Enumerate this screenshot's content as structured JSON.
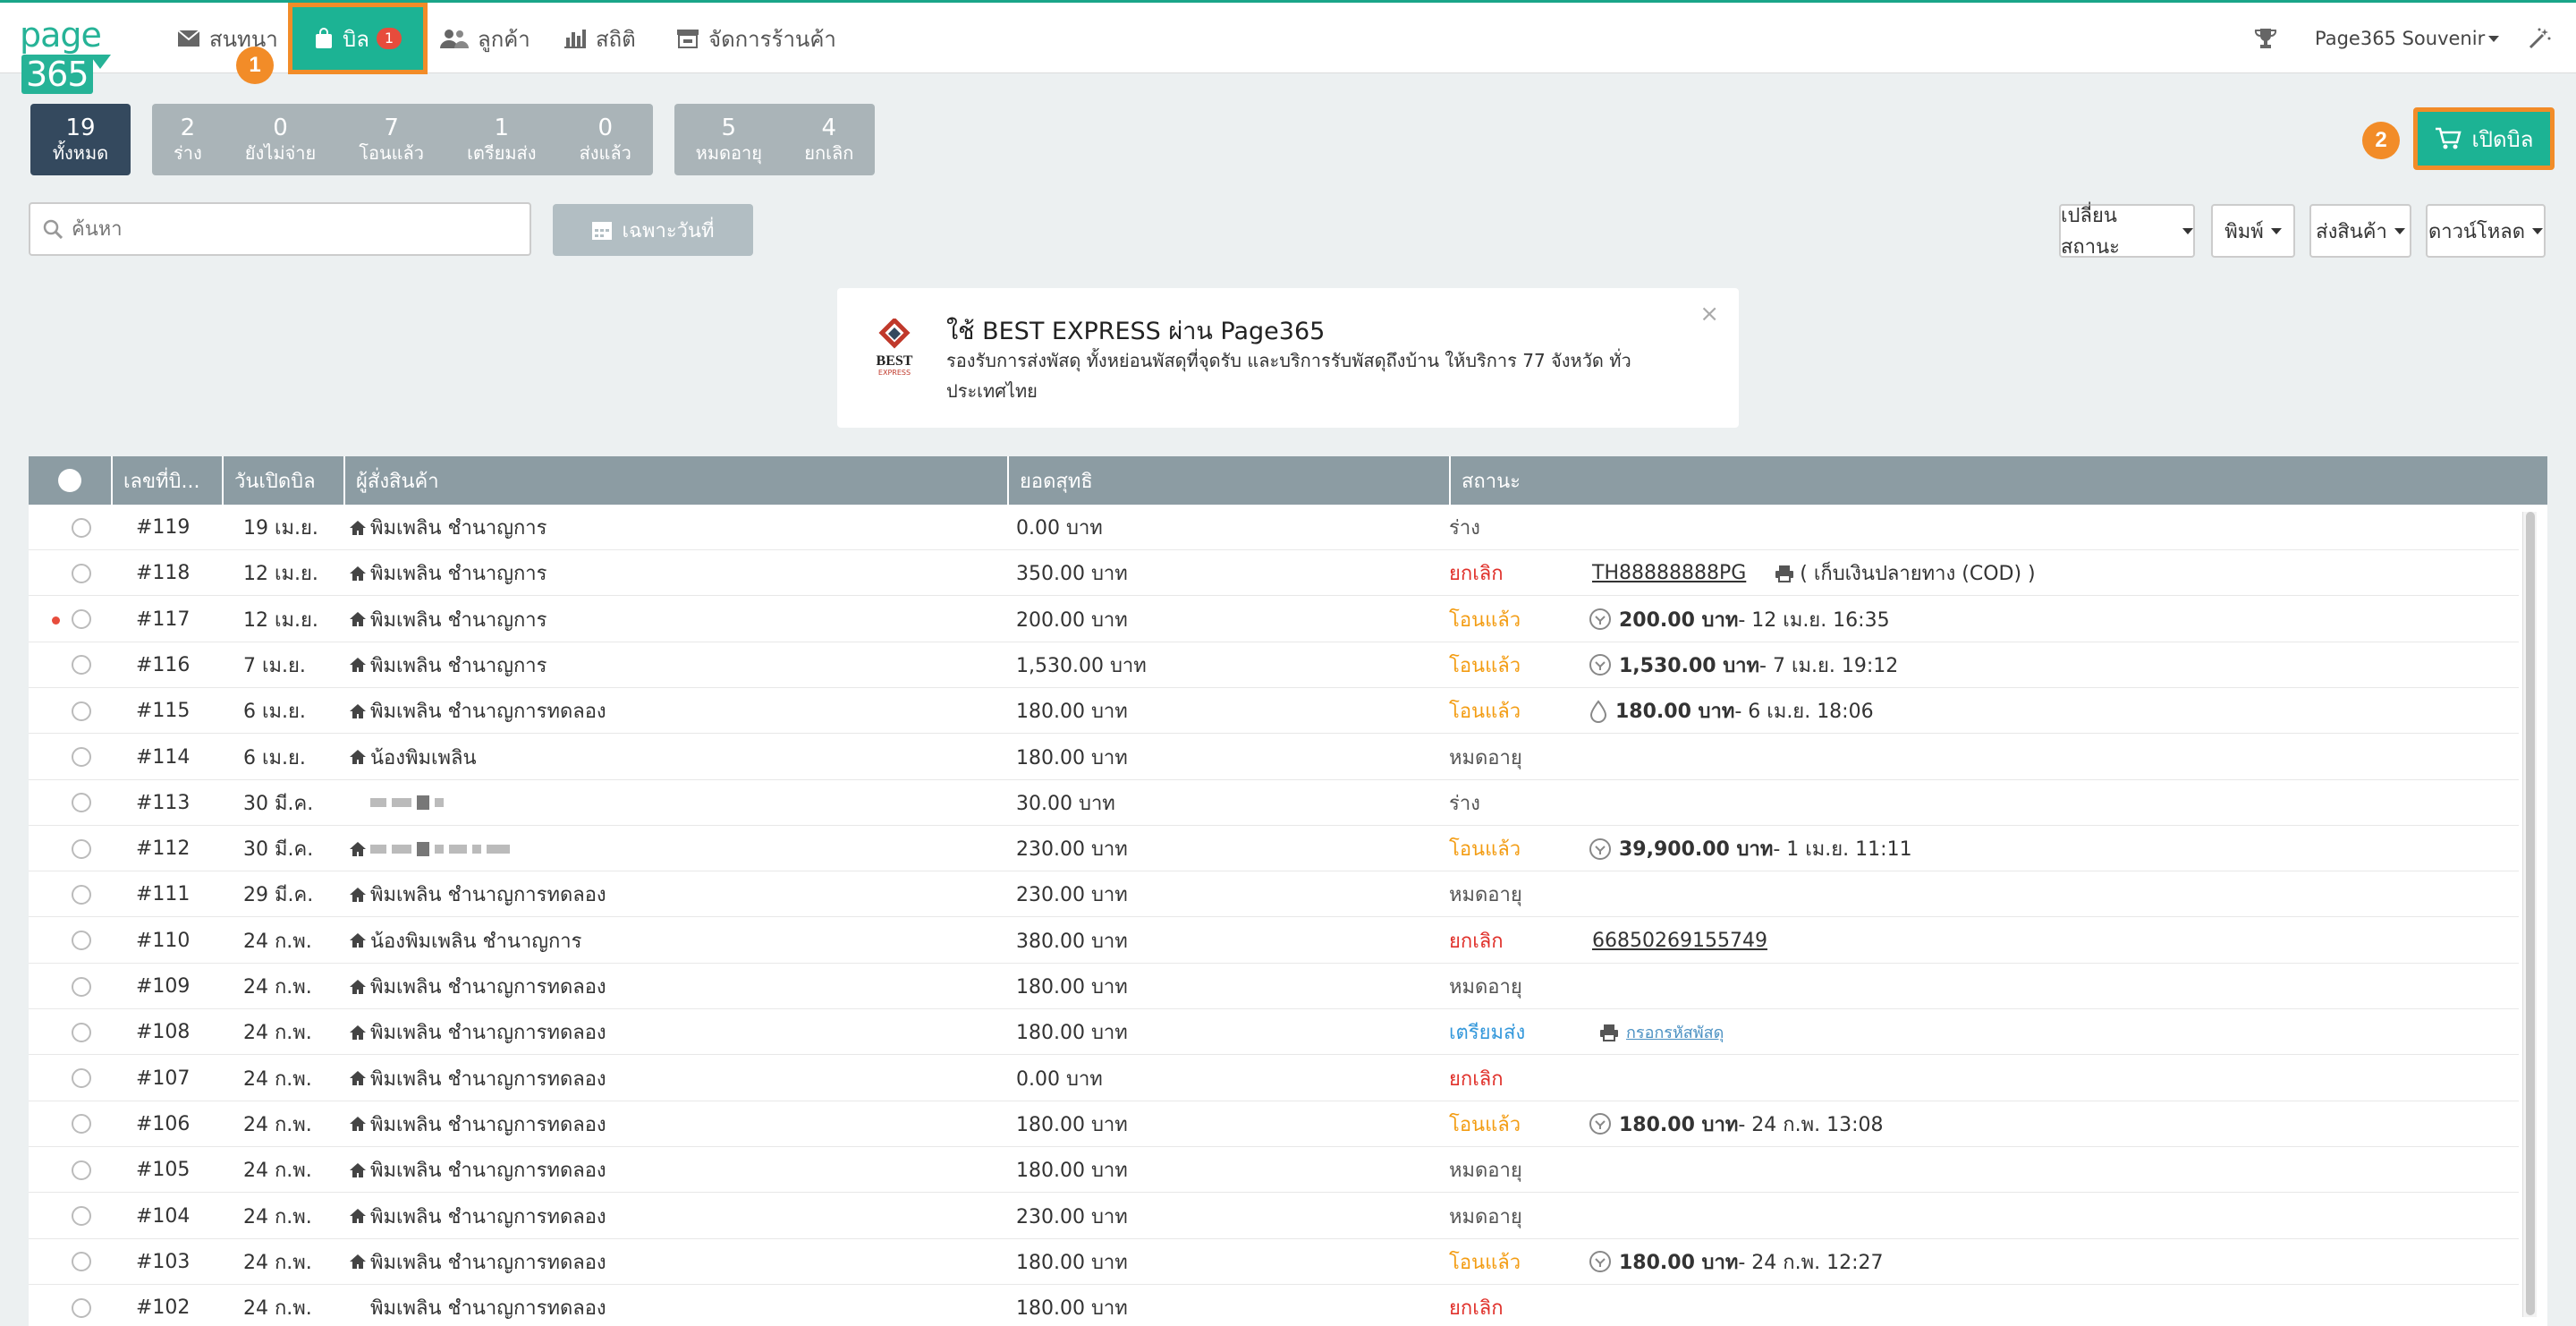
{
  "brand": {
    "logo_text": "page",
    "logo_num": "365"
  },
  "nav": {
    "items": [
      {
        "label": "สนทนา"
      },
      {
        "label": "บิล",
        "badge": "1"
      },
      {
        "label": "ลูกค้า"
      },
      {
        "label": "สถิติ"
      },
      {
        "label": "จัดการร้านค้า"
      }
    ],
    "account": "Page365 Souvenir"
  },
  "callouts": {
    "one": "1",
    "two": "2"
  },
  "filters": {
    "all": {
      "count": "19",
      "label": "ทั้งหมด"
    },
    "group1": [
      {
        "count": "2",
        "label": "ร่าง"
      },
      {
        "count": "0",
        "label": "ยังไม่จ่าย"
      },
      {
        "count": "7",
        "label": "โอนแล้ว"
      },
      {
        "count": "1",
        "label": "เตรียมส่ง"
      },
      {
        "count": "0",
        "label": "ส่งแล้ว"
      }
    ],
    "group2": [
      {
        "count": "5",
        "label": "หมดอายุ"
      },
      {
        "count": "4",
        "label": "ยกเลิก"
      }
    ]
  },
  "toolbar": {
    "search_placeholder": "ค้นหา",
    "date_label": "เฉพาะวันที่",
    "change_status": "เปลี่ยนสถานะ",
    "print": "พิมพ์",
    "ship": "ส่งสินค้า",
    "download": "ดาวน์โหลด",
    "open_bill": "เปิดบิล"
  },
  "banner": {
    "logo_text": "BEST",
    "logo_sub": "EXPRESS",
    "title": "ใช้ BEST EXPRESS ผ่าน Page365",
    "body": "รองรับการส่งพัสดุ ทั้งหย่อนพัสดุที่จุดรับ และบริการรับพัสดุถึงบ้าน ให้บริการ 77 จังหวัด ทั่วประเทศไทย",
    "close": "×"
  },
  "table": {
    "headers": [
      "เลขที่บิ...",
      "วันเปิดบิล",
      "ผู้สั่งสินค้า",
      "ยอดสุทธิ",
      "สถานะ"
    ],
    "rows": [
      {
        "id": "#119",
        "date": "19 เม.ย.",
        "customer": "พิมเพลิน ชำนาญการ",
        "total": "0.00 บาท",
        "status": "ร่าง",
        "tone": "gray",
        "extra": "",
        "extra2": ""
      },
      {
        "id": "#118",
        "date": "12 เม.ย.",
        "customer": "พิมเพลิน ชำนาญการ",
        "total": "350.00 บาท",
        "status": "ยกเลิก",
        "tone": "red",
        "extra": "TH88888888PG",
        "extra2": "( เก็บเงินปลายทาง (COD) )"
      },
      {
        "id": "#117",
        "date": "12 เม.ย.",
        "customer": "พิมเพลิน ชำนาญการ",
        "total": "200.00 บาท",
        "status": "โอนแล้ว",
        "tone": "orange",
        "extra": "200.00 บาท",
        "extra2": "- 12 เม.ย. 16:35"
      },
      {
        "id": "#116",
        "date": "7 เม.ย.",
        "customer": "พิมเพลิน ชำนาญการ",
        "total": "1,530.00 บาท",
        "status": "โอนแล้ว",
        "tone": "orange",
        "extra": "1,530.00 บาท",
        "extra2": "- 7 เม.ย. 19:12"
      },
      {
        "id": "#115",
        "date": "6 เม.ย.",
        "customer": "พิมเพลิน ชำนาญการทดลอง",
        "total": "180.00 บาท",
        "status": "โอนแล้ว",
        "tone": "orange",
        "extra": "180.00 บาท",
        "extra2": "- 6 เม.ย. 18:06"
      },
      {
        "id": "#114",
        "date": "6 เม.ย.",
        "customer": "น้องพิมเพลิน",
        "total": "180.00 บาท",
        "status": "หมดอายุ",
        "tone": "gray",
        "extra": "",
        "extra2": ""
      },
      {
        "id": "#113",
        "date": "30 มี.ค.",
        "customer": "",
        "total": "30.00 บาท",
        "status": "ร่าง",
        "tone": "gray",
        "extra": "",
        "extra2": ""
      },
      {
        "id": "#112",
        "date": "30 มี.ค.",
        "customer": "",
        "total": "230.00 บาท",
        "status": "โอนแล้ว",
        "tone": "orange",
        "extra": "39,900.00 บาท",
        "extra2": "- 1 เม.ย. 11:11"
      },
      {
        "id": "#111",
        "date": "29 มี.ค.",
        "customer": "พิมเพลิน ชำนาญการทดลอง",
        "total": "230.00 บาท",
        "status": "หมดอายุ",
        "tone": "gray",
        "extra": "",
        "extra2": ""
      },
      {
        "id": "#110",
        "date": "24 ก.พ.",
        "customer": "น้องพิมเพลิน ชำนาญการ",
        "total": "380.00 บาท",
        "status": "ยกเลิก",
        "tone": "red",
        "extra": "66850269155749",
        "extra2": ""
      },
      {
        "id": "#109",
        "date": "24 ก.พ.",
        "customer": "พิมเพลิน ชำนาญการทดลอง",
        "total": "180.00 บาท",
        "status": "หมดอายุ",
        "tone": "gray",
        "extra": "",
        "extra2": ""
      },
      {
        "id": "#108",
        "date": "24 ก.พ.",
        "customer": "พิมเพลิน ชำนาญการทดลอง",
        "total": "180.00 บาท",
        "status": "เตรียมส่ง",
        "tone": "blue",
        "extra": "",
        "extra2": "กรอกรหัสพัสดุ"
      },
      {
        "id": "#107",
        "date": "24 ก.พ.",
        "customer": "พิมเพลิน ชำนาญการทดลอง",
        "total": "0.00 บาท",
        "status": "ยกเลิก",
        "tone": "red",
        "extra": "",
        "extra2": ""
      },
      {
        "id": "#106",
        "date": "24 ก.พ.",
        "customer": "พิมเพลิน ชำนาญการทดลอง",
        "total": "180.00 บาท",
        "status": "โอนแล้ว",
        "tone": "orange",
        "extra": "180.00 บาท",
        "extra2": "- 24 ก.พ. 13:08"
      },
      {
        "id": "#105",
        "date": "24 ก.พ.",
        "customer": "พิมเพลิน ชำนาญการทดลอง",
        "total": "180.00 บาท",
        "status": "หมดอายุ",
        "tone": "gray",
        "extra": "",
        "extra2": ""
      },
      {
        "id": "#104",
        "date": "24 ก.พ.",
        "customer": "พิมเพลิน ชำนาญการทดลอง",
        "total": "230.00 บาท",
        "status": "หมดอายุ",
        "tone": "gray",
        "extra": "",
        "extra2": ""
      },
      {
        "id": "#103",
        "date": "24 ก.พ.",
        "customer": "พิมเพลิน ชำนาญการทดลอง",
        "total": "180.00 บาท",
        "status": "โอนแล้ว",
        "tone": "orange",
        "extra": "180.00 บาท",
        "extra2": "- 24 ก.พ. 12:27"
      },
      {
        "id": "#102",
        "date": "24 ก.พ.",
        "customer": "พิมเพลิน ชำนาญการทดลอง",
        "total": "180.00 บาท",
        "status": "ยกเลิก",
        "tone": "red",
        "extra": "",
        "extra2": ""
      }
    ]
  },
  "colors": {
    "brand": "#1cb394",
    "highlight": "#f28c28",
    "header": "#8c9ca3",
    "cancel": "#e0312b",
    "paid": "#f39c12",
    "prepare": "#3498db"
  }
}
